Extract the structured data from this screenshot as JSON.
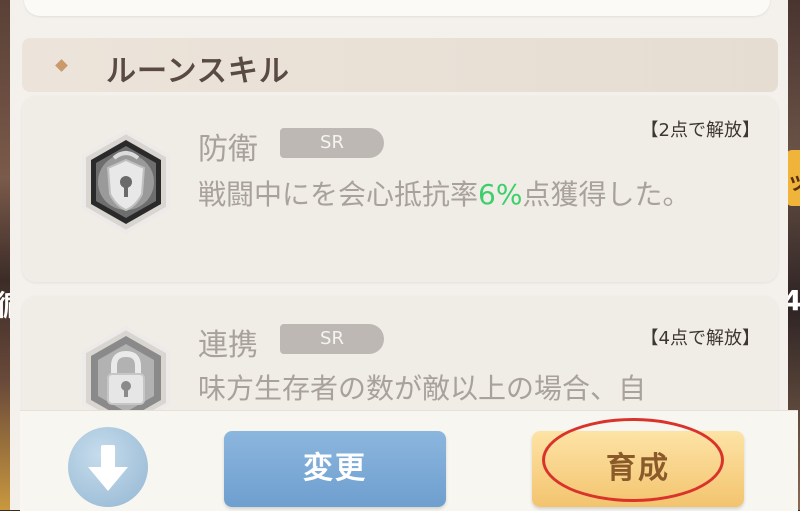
{
  "background": {
    "left_fragment": "循",
    "right_fragment": "4",
    "right_badge_fragment": "ッ"
  },
  "section": {
    "title": "ルーンスキル",
    "accent_color": "#c89a6c"
  },
  "skills": [
    {
      "name": "防衛",
      "rarity": "SR",
      "unlock": "【2点で解放】",
      "desc_before": "戦闘中にを会心抵抗率",
      "desc_value": "6%",
      "desc_after": "点獲得した。",
      "icon": "shield-lock-icon",
      "highlight_color": "#3ccf6b"
    },
    {
      "name": "連携",
      "rarity": "SR",
      "unlock": "【4点で解放】",
      "desc": "味方生存者の数が敵以上の場合、自",
      "icon": "lock-icon"
    }
  ],
  "bottom": {
    "down_icon": "arrow-down-icon",
    "change_label": "変更",
    "grow_label": "育成"
  }
}
